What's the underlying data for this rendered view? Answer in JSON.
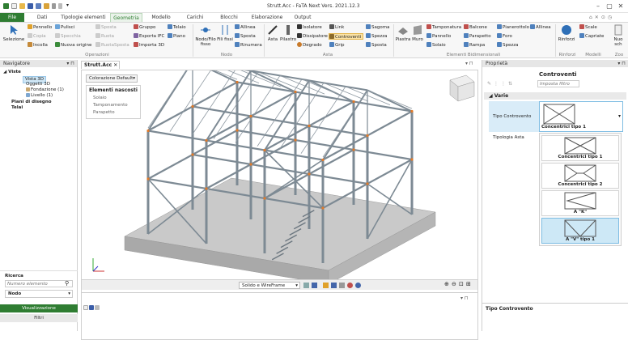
{
  "app": {
    "title": "Strutt.Acc - FaTA Next Vers. 2021.12.3"
  },
  "quick_access": {
    "extra": "▾"
  },
  "window": {
    "minimize": "–",
    "maximize": "▢",
    "close": "✕"
  },
  "tabs": [
    "File",
    "Dati",
    "Tipologie elementi",
    "Geometria",
    "Modello",
    "Carichi",
    "Blocchi",
    "Elaborazione",
    "Output"
  ],
  "ribbon": {
    "selezione": "Selezione",
    "pennello": "Pennello",
    "pulisci": "Pulisci",
    "copia": "Copia",
    "specchia": "Specchia",
    "incolla": "Incolla",
    "nuova_origine": "Nuova origine",
    "sposta": "Sposta",
    "ruota": "Ruota",
    "ruota_sposta": "RuotaSposta",
    "gruppo": "Gruppo",
    "telaio": "Telaio",
    "esporta_ifc": "Esporta IFC",
    "piano": "Piano",
    "importa_3d": "Importa 3D",
    "nodo_filo_fisso": "Nodo/Filo fisso",
    "fili_fissi": "Fili fissi",
    "allinea": "Allinea",
    "sposta_n": "Sposta",
    "rinumera": "Rinumera",
    "asta": "Asta",
    "pilastro": "Pilastro",
    "isolatore": "Isolatore",
    "dissipatore": "Dissipatore",
    "degrado": "Degrado",
    "link": "Link",
    "controventi": "Controventi",
    "grip": "Grip",
    "sagoma": "Sagoma",
    "spezza": "Spezza",
    "sposta_a": "Sposta",
    "piastra": "Piastra",
    "muro": "Muro",
    "tamponatura": "Tamponatura",
    "pannello": "Pannello",
    "solaio": "Solaio",
    "balcone": "Balcone",
    "parapetto": "Parapetto",
    "rampa": "Rampa",
    "pianerottolo": "Pianerottolo",
    "foro": "Foro",
    "spezza_b": "Spezza",
    "allinea_b": "Allinea",
    "rinforzi": "Rinforzi",
    "scale": "Scale",
    "capriate": "Capriate",
    "nuovo": "Nuo sch",
    "groups": {
      "operazioni": "Operazioni",
      "nodo": "Nodo",
      "asta": "Asta",
      "bidim": "Elementi Bidimensionali",
      "rinforzi": "Rinforzi",
      "modelli": "Modelli",
      "zoom": "Zoo"
    }
  },
  "navigator": {
    "title": "Navigatore",
    "pin": "▾ ⊓",
    "tree": [
      {
        "label": "Viste",
        "level": 0,
        "bold": true,
        "toggle": "◢"
      },
      {
        "label": "Vista 3D",
        "level": 2,
        "selected": true
      },
      {
        "label": "Oggetti 3D",
        "level": 2
      },
      {
        "label": "Fondazione (1)",
        "level": 2
      },
      {
        "label": "Livello (1)",
        "level": 2
      },
      {
        "label": "Piani di disegno",
        "level": 0,
        "bold": true
      },
      {
        "label": "Telai",
        "level": 0,
        "bold": true
      }
    ],
    "ricerca_label": "Ricerca",
    "search_placeholder": "Numero elemento",
    "node_value": "Nodo",
    "btn_vis": "Visualizzazione",
    "btn_filtri": "Filtri"
  },
  "center": {
    "tab": "Strutt.Acc",
    "coloring": "Colorazione Default",
    "hidden_title": "Elementi nascosti",
    "hidden_items": [
      "Solaio",
      "Tamponamento",
      "Parapetto"
    ],
    "render_mode": "Solido e WireFrame"
  },
  "properties": {
    "title": "Proprietà",
    "header": "Controventi",
    "filter_placeholder": "Imposta filtro",
    "section": "Varie",
    "rows": [
      {
        "label": "Tipo Controvento",
        "value": "Concentrici tipo 1"
      },
      {
        "label": "Tipologia Asta",
        "value": ""
      }
    ],
    "options": [
      {
        "label": "Concentrici tipo 1",
        "shape": "x"
      },
      {
        "label": "Concentrici tipo 2",
        "shape": "x2"
      },
      {
        "label": "A \"K\"",
        "shape": "k"
      },
      {
        "label": "A \"V\" tipo 1",
        "shape": "v",
        "selected": true
      }
    ],
    "footer": "Tipo Controvento"
  },
  "colors": {
    "accent": "#2f7d32",
    "select": "#cde8f6",
    "steel": "#7d8a94",
    "brace": "#e07a2a"
  }
}
